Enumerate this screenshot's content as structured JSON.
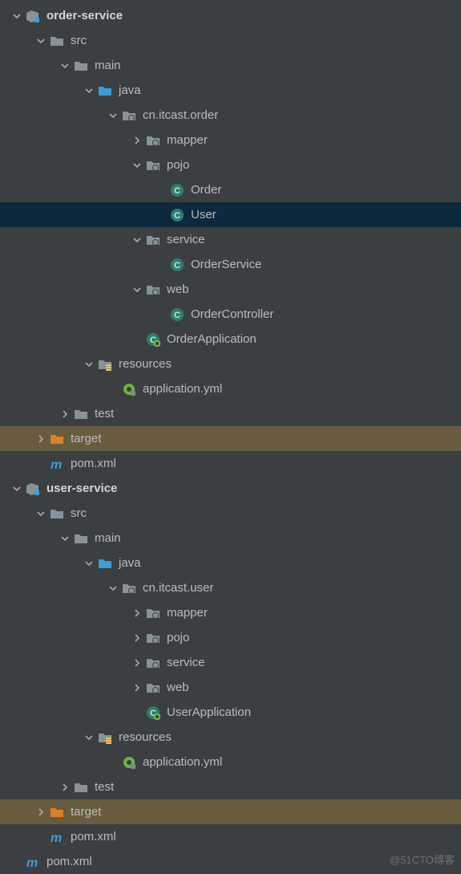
{
  "watermark": "@51CTO博客",
  "nodes": [
    {
      "indent": 0,
      "arrow": "down",
      "icon": "module",
      "label": "order-service",
      "bold": true,
      "sel": false,
      "hl": false
    },
    {
      "indent": 1,
      "arrow": "down",
      "icon": "folder",
      "label": "src",
      "bold": false,
      "sel": false,
      "hl": false
    },
    {
      "indent": 2,
      "arrow": "down",
      "icon": "folder",
      "label": "main",
      "bold": false,
      "sel": false,
      "hl": false
    },
    {
      "indent": 3,
      "arrow": "down",
      "icon": "folder-src",
      "label": "java",
      "bold": false,
      "sel": false,
      "hl": false
    },
    {
      "indent": 4,
      "arrow": "down",
      "icon": "package",
      "label": "cn.itcast.order",
      "bold": false,
      "sel": false,
      "hl": false
    },
    {
      "indent": 5,
      "arrow": "right",
      "icon": "package",
      "label": "mapper",
      "bold": false,
      "sel": false,
      "hl": false
    },
    {
      "indent": 5,
      "arrow": "down",
      "icon": "package",
      "label": "pojo",
      "bold": false,
      "sel": false,
      "hl": false
    },
    {
      "indent": 6,
      "arrow": "none",
      "icon": "class",
      "label": "Order",
      "bold": false,
      "sel": false,
      "hl": false
    },
    {
      "indent": 6,
      "arrow": "none",
      "icon": "class",
      "label": "User",
      "bold": false,
      "sel": true,
      "hl": false
    },
    {
      "indent": 5,
      "arrow": "down",
      "icon": "package",
      "label": "service",
      "bold": false,
      "sel": false,
      "hl": false
    },
    {
      "indent": 6,
      "arrow": "none",
      "icon": "class",
      "label": "OrderService",
      "bold": false,
      "sel": false,
      "hl": false
    },
    {
      "indent": 5,
      "arrow": "down",
      "icon": "package",
      "label": "web",
      "bold": false,
      "sel": false,
      "hl": false
    },
    {
      "indent": 6,
      "arrow": "none",
      "icon": "class",
      "label": "OrderController",
      "bold": false,
      "sel": false,
      "hl": false
    },
    {
      "indent": 5,
      "arrow": "none",
      "icon": "spring",
      "label": "OrderApplication",
      "bold": false,
      "sel": false,
      "hl": false
    },
    {
      "indent": 3,
      "arrow": "down",
      "icon": "resources",
      "label": "resources",
      "bold": false,
      "sel": false,
      "hl": false
    },
    {
      "indent": 4,
      "arrow": "none",
      "icon": "yml",
      "label": "application.yml",
      "bold": false,
      "sel": false,
      "hl": false
    },
    {
      "indent": 2,
      "arrow": "right",
      "icon": "folder",
      "label": "test",
      "bold": false,
      "sel": false,
      "hl": false
    },
    {
      "indent": 1,
      "arrow": "right",
      "icon": "folder-target",
      "label": "target",
      "bold": false,
      "sel": false,
      "hl": true
    },
    {
      "indent": 1,
      "arrow": "none",
      "icon": "maven",
      "label": "pom.xml",
      "bold": false,
      "sel": false,
      "hl": false
    },
    {
      "indent": 0,
      "arrow": "down",
      "icon": "module",
      "label": "user-service",
      "bold": true,
      "sel": false,
      "hl": false
    },
    {
      "indent": 1,
      "arrow": "down",
      "icon": "folder",
      "label": "src",
      "bold": false,
      "sel": false,
      "hl": false
    },
    {
      "indent": 2,
      "arrow": "down",
      "icon": "folder",
      "label": "main",
      "bold": false,
      "sel": false,
      "hl": false
    },
    {
      "indent": 3,
      "arrow": "down",
      "icon": "folder-src",
      "label": "java",
      "bold": false,
      "sel": false,
      "hl": false
    },
    {
      "indent": 4,
      "arrow": "down",
      "icon": "package",
      "label": "cn.itcast.user",
      "bold": false,
      "sel": false,
      "hl": false
    },
    {
      "indent": 5,
      "arrow": "right",
      "icon": "package",
      "label": "mapper",
      "bold": false,
      "sel": false,
      "hl": false
    },
    {
      "indent": 5,
      "arrow": "right",
      "icon": "package",
      "label": "pojo",
      "bold": false,
      "sel": false,
      "hl": false
    },
    {
      "indent": 5,
      "arrow": "right",
      "icon": "package",
      "label": "service",
      "bold": false,
      "sel": false,
      "hl": false
    },
    {
      "indent": 5,
      "arrow": "right",
      "icon": "package",
      "label": "web",
      "bold": false,
      "sel": false,
      "hl": false
    },
    {
      "indent": 5,
      "arrow": "none",
      "icon": "spring",
      "label": "UserApplication",
      "bold": false,
      "sel": false,
      "hl": false
    },
    {
      "indent": 3,
      "arrow": "down",
      "icon": "resources",
      "label": "resources",
      "bold": false,
      "sel": false,
      "hl": false
    },
    {
      "indent": 4,
      "arrow": "none",
      "icon": "yml",
      "label": "application.yml",
      "bold": false,
      "sel": false,
      "hl": false
    },
    {
      "indent": 2,
      "arrow": "right",
      "icon": "folder",
      "label": "test",
      "bold": false,
      "sel": false,
      "hl": false
    },
    {
      "indent": 1,
      "arrow": "right",
      "icon": "folder-target",
      "label": "target",
      "bold": false,
      "sel": false,
      "hl": true
    },
    {
      "indent": 1,
      "arrow": "none",
      "icon": "maven",
      "label": "pom.xml",
      "bold": false,
      "sel": false,
      "hl": false
    },
    {
      "indent": 0,
      "arrow": "none",
      "icon": "maven",
      "label": "pom.xml",
      "bold": false,
      "sel": false,
      "hl": false
    }
  ]
}
